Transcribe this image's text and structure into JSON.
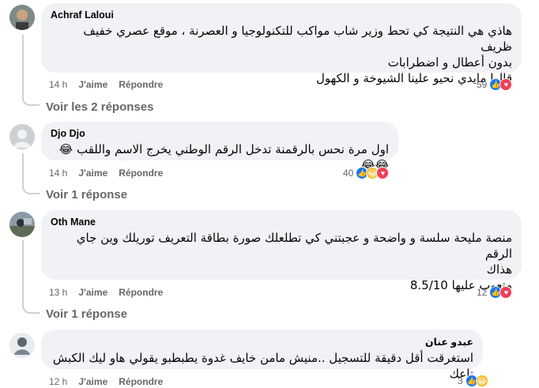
{
  "comments": [
    {
      "author": "Achraf Laloui",
      "lines": [
        "هاذي هي النتيجة كي تحط وزير شاب مواكب للتكنولوجيا و العصرنة ، موقع عصري خفيف ظريف",
        "بدون أعطال و اضطرابات",
        "قالها مايدي نحيو علينا الشيوخة و الكهول"
      ],
      "time": "14 h",
      "like": "J'aime",
      "reply": "Répondre",
      "reaction_count": "59",
      "reactions": [
        "like-icon",
        "love-icon"
      ],
      "view_replies": "Voir les 2 réponses"
    },
    {
      "author": "Djo Djo",
      "lines": [
        "اول مرة نحس بالرقمنة تدخل الرقم الوطني يخرج الاسم واللقب 😂😂😂"
      ],
      "time": "14 h",
      "like": "J'aime",
      "reply": "Répondre",
      "reaction_count": "40",
      "reactions": [
        "like-icon",
        "haha-icon",
        "love-icon"
      ],
      "view_replies": "Voir 1 réponse"
    },
    {
      "author": "Oth Mane",
      "lines": [
        "منصة مليحة سلسة و واضحة و عجبتني كي تطلعلك صورة بطاقة التعريف توريلك وين جاي الرقم",
        "هذاك",
        "متعوب عليها 8.5/10"
      ],
      "time": "13 h",
      "like": "J'aime",
      "reply": "Répondre",
      "reaction_count": "12",
      "reactions": [
        "like-icon",
        "love-icon"
      ],
      "view_replies": "Voir 1 réponse"
    },
    {
      "author": "عبدو عنان",
      "lines": [
        "استغرقت أقل دقيقة للتسجيل ..منيش مامن خايف غدوة يطبطبو يقولي هاو ليك الكبش تاعك"
      ],
      "time": "12 h",
      "like": "J'aime",
      "reply": "Répondre",
      "reaction_count": "3",
      "reactions": [
        "like-icon",
        "haha-icon"
      ]
    }
  ],
  "colors": {
    "bubble": "#f0f2f5",
    "secondary_text": "#65676b",
    "like": "#1877f2",
    "love": "#f33e58",
    "haha": "#f7b928"
  }
}
